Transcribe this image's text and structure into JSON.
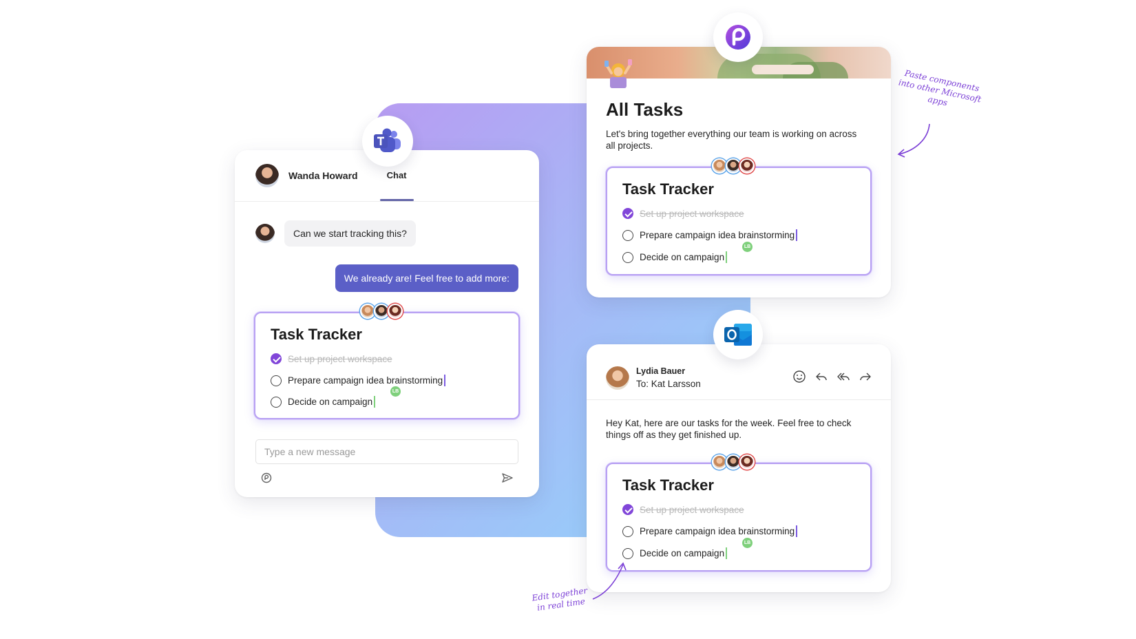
{
  "teams": {
    "user_name": "Wanda Howard",
    "tab_label": "Chat",
    "incoming_message": "Can we start tracking this?",
    "outgoing_message": "We already are! Feel free to add more:",
    "compose_placeholder": "Type a new message"
  },
  "tracker": {
    "title": "Task Tracker",
    "tasks": [
      {
        "label": "Set up project workspace",
        "done": true
      },
      {
        "label": "Prepare campaign idea brainstorming",
        "done": false
      },
      {
        "label": "Decide on campaign",
        "done": false
      }
    ],
    "coauthor_initials": "LB"
  },
  "loop": {
    "title": "All Tasks",
    "description": "Let's bring together everything our team is working on across all projects."
  },
  "outlook": {
    "sender": "Lydia Bauer",
    "recipient": "To: Kat Larsson",
    "body": "Hey Kat, here are our tasks for the week. Feel free to check things off as they get finished up."
  },
  "annotations": {
    "paste_note": "Paste components into other Microsoft apps",
    "edit_note": "Edit together in real time"
  },
  "icons": {
    "teams": "teams-logo-icon",
    "loop": "loop-logo-icon",
    "outlook": "outlook-logo-icon",
    "emoji": "smiley-icon",
    "reply": "reply-icon",
    "reply_all": "reply-all-icon",
    "forward": "forward-icon",
    "send": "send-icon",
    "compose_tool": "loop-compose-icon"
  },
  "colors": {
    "accent": "#5b5fc7",
    "check": "#8146d9",
    "tracker_border": "#b7a0f3",
    "annotation": "#7b3fd6"
  }
}
